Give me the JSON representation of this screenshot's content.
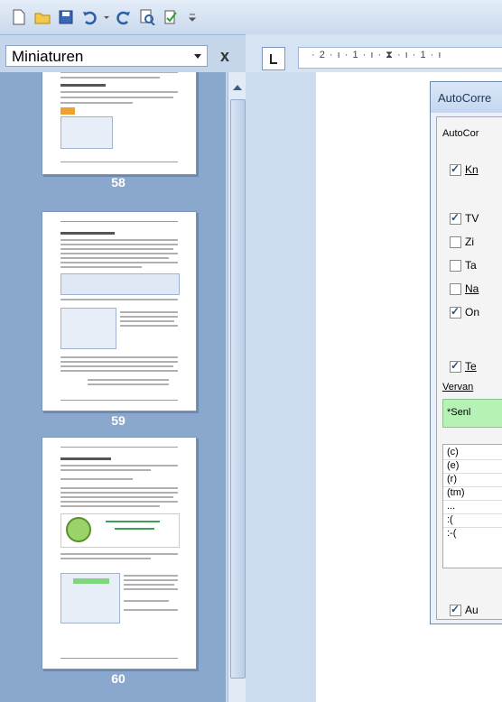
{
  "quick_access": {
    "icons": [
      "new-document-icon",
      "open-folder-icon",
      "save-icon",
      "undo-icon",
      "redo-icon",
      "print-preview-icon",
      "spelling-icon",
      "customize-arrow-icon"
    ]
  },
  "nav_pane": {
    "view_select": "Miniaturen",
    "close_label": "x",
    "pages": [
      {
        "number": "58"
      },
      {
        "number": "59"
      },
      {
        "number": "60"
      }
    ]
  },
  "ruler": {
    "text": "· 2 · ı · 1 · ı · ⧗ · ı · 1 · ı"
  },
  "dialog": {
    "title": "AutoCorre",
    "tab": "AutoCor",
    "checkboxes": [
      {
        "label": "Kn",
        "checked": true
      },
      {
        "label": "TV",
        "checked": true
      },
      {
        "label": "Zi",
        "checked": false
      },
      {
        "label": "Ta",
        "checked": false
      },
      {
        "label": "Na",
        "checked": false
      },
      {
        "label": "On",
        "checked": true
      }
    ],
    "replace_checkbox": {
      "label": "Te",
      "checked": true
    },
    "replace_label": "Vervan",
    "replace_value": "*Senl",
    "list_items": [
      "(c)",
      "(e)",
      "(r)",
      "(tm)",
      "...",
      ":(",
      ":-("
    ],
    "bottom_checkbox": {
      "label": "Au",
      "checked": true
    }
  },
  "colors": {
    "accent_green": "#b6f2b6",
    "nav_bg": "#8aa7cd"
  }
}
